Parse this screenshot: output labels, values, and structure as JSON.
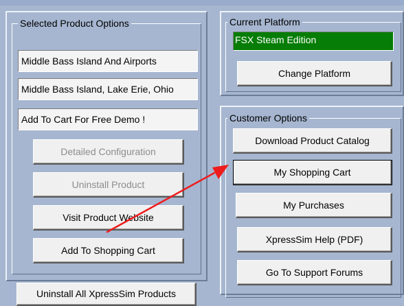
{
  "selected_product": {
    "title": "Selected Product Options",
    "product_name": "Middle Bass Island And Airports",
    "location": "Middle Bass Island, Lake Erie, Ohio",
    "status": "Add To Cart For Free Demo !",
    "buttons": {
      "detailed_configuration": "Detailed Configuration",
      "uninstall_product": "Uninstall Product",
      "visit_website": "Visit Product Website",
      "add_to_cart": "Add To Shopping Cart"
    }
  },
  "bottom_button": {
    "label": "Uninstall All XpressSim Products"
  },
  "current_platform": {
    "title": "Current Platform",
    "value": "FSX Steam Edition",
    "change_button": "Change Platform",
    "value_color": "#067d06"
  },
  "customer_options": {
    "title": "Customer Options",
    "buttons": {
      "download_catalog": "Download Product Catalog",
      "shopping_cart": "My Shopping Cart",
      "purchases": "My Purchases",
      "help_pdf": "XpressSim Help (PDF)",
      "support_forums": "Go To Support Forums"
    }
  },
  "annotation": {
    "arrow_color": "#ee1c1c"
  }
}
